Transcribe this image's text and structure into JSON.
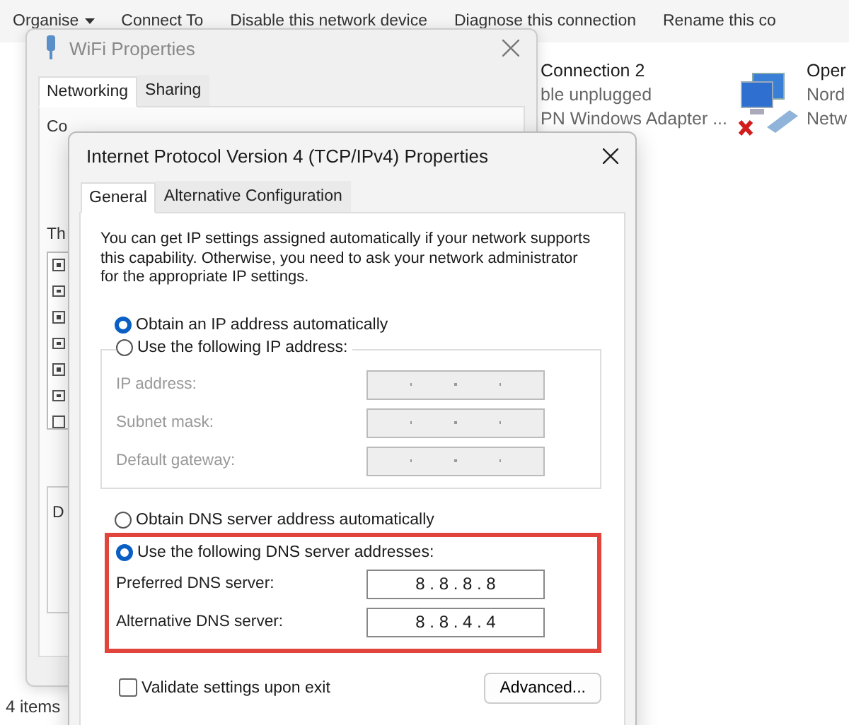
{
  "explorer": {
    "toolbar": [
      {
        "label": "Organise",
        "dropdown": true
      },
      {
        "label": "Connect To",
        "dropdown": false
      },
      {
        "label": "Disable this network device",
        "dropdown": false
      },
      {
        "label": "Diagnose this connection",
        "dropdown": false
      },
      {
        "label": "Rename this co",
        "dropdown": false
      }
    ],
    "connections": [
      {
        "kind": "text",
        "name": "Connection 2",
        "status": "ble unplugged",
        "device": "PN Windows Adapter ..."
      },
      {
        "kind": "icon",
        "name": "Oper",
        "status": "Nord",
        "device": "Netw"
      }
    ],
    "status_bar": "4 items"
  },
  "wifi_window": {
    "title": "WiFi Properties",
    "tabs": [
      {
        "label": "Networking",
        "selected": true
      },
      {
        "label": "Sharing",
        "selected": false
      }
    ],
    "connect_label": "Co",
    "list_label": "Th",
    "description_label": "D",
    "components": [
      {
        "checked": true
      },
      {
        "checked": true
      },
      {
        "checked": true
      },
      {
        "checked": true
      },
      {
        "checked": true
      },
      {
        "checked": true
      },
      {
        "checked": false
      }
    ]
  },
  "ipv4_window": {
    "title": "Internet Protocol Version 4 (TCP/IPv4) Properties",
    "tabs": [
      {
        "label": "General",
        "selected": true
      },
      {
        "label": "Alternative Configuration",
        "selected": false
      }
    ],
    "intro": "You can get IP settings assigned automatically if your network supports this capability. Otherwise, you need to ask your network administrator for the appropriate IP settings.",
    "ip_options": [
      {
        "label": "Obtain an IP address automatically",
        "selected": true
      },
      {
        "label": "Use the following IP address:",
        "selected": false
      }
    ],
    "ip_fields": [
      {
        "label": "IP address:",
        "disabled": true
      },
      {
        "label": "Subnet mask:",
        "disabled": true
      },
      {
        "label": "Default gateway:",
        "disabled": true
      }
    ],
    "dns_options": [
      {
        "label": "Obtain DNS server address automatically",
        "selected": false
      },
      {
        "label": "Use the following DNS server addresses:",
        "selected": true
      }
    ],
    "dns_fields": [
      {
        "label": "Preferred DNS server:",
        "value": "8 . 8 . 8 . 8",
        "disabled": false
      },
      {
        "label": "Alternative DNS server:",
        "value": "8 . 8 . 4 . 4",
        "disabled": false
      }
    ],
    "dns_highlighted": true,
    "validate": {
      "label": "Validate settings upon exit",
      "checked": false
    },
    "advanced_button": "Advanced..."
  }
}
